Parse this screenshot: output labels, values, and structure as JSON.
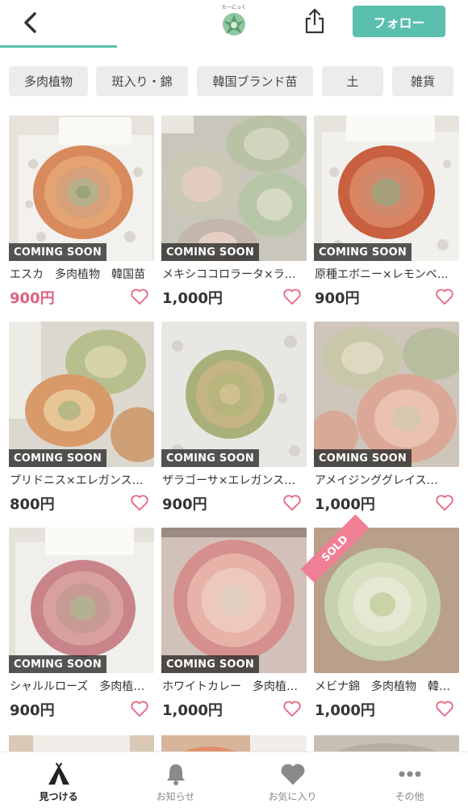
{
  "header": {
    "logo_caption": "たーにっく",
    "follow_label": "フォロー",
    "accent_color": "#5bbfad"
  },
  "categories": [
    "多肉植物",
    "斑入り・錦",
    "韓国ブランド苗",
    "土",
    "雑貨"
  ],
  "products": [
    {
      "title": "エスカ　多肉植物　韓国苗",
      "price": "900円",
      "badge": "COMING SOON",
      "price_sale": true
    },
    {
      "title": "メキシココロラータ×ラ…",
      "price": "1,000円",
      "badge": "COMING SOON",
      "price_sale": false
    },
    {
      "title": "原種エボニー×レモンベ…",
      "price": "900円",
      "badge": "COMING SOON",
      "price_sale": false
    },
    {
      "title": "プリドニス×エレガンス…",
      "price": "800円",
      "badge": "COMING SOON",
      "price_sale": false
    },
    {
      "title": "ザラゴーサ×エレガンス…",
      "price": "900円",
      "badge": "COMING SOON",
      "price_sale": false
    },
    {
      "title": "アメイジンググレイス…",
      "price": "1,000円",
      "badge": "COMING SOON",
      "price_sale": false
    },
    {
      "title": "シャルルローズ　多肉植…",
      "price": "900円",
      "badge": "COMING SOON",
      "price_sale": false
    },
    {
      "title": "ホワイトカレー　多肉植…",
      "price": "1,000円",
      "badge": "COMING SOON",
      "price_sale": false
    },
    {
      "title": "メビナ錦　多肉植物　韓…",
      "price": "1,000円",
      "badge": "SOLD",
      "price_sale": false
    }
  ],
  "tabs": [
    {
      "label": "見つける",
      "icon": "tent-icon",
      "active": true
    },
    {
      "label": "お知らせ",
      "icon": "bell-icon",
      "active": false
    },
    {
      "label": "お気に入り",
      "icon": "heart-icon",
      "active": false
    },
    {
      "label": "その他",
      "icon": "more-icon",
      "active": false
    }
  ],
  "colors": {
    "sale_price": "#e0607e",
    "heart": "#e8657f",
    "sold_ribbon": "#f07e94"
  }
}
